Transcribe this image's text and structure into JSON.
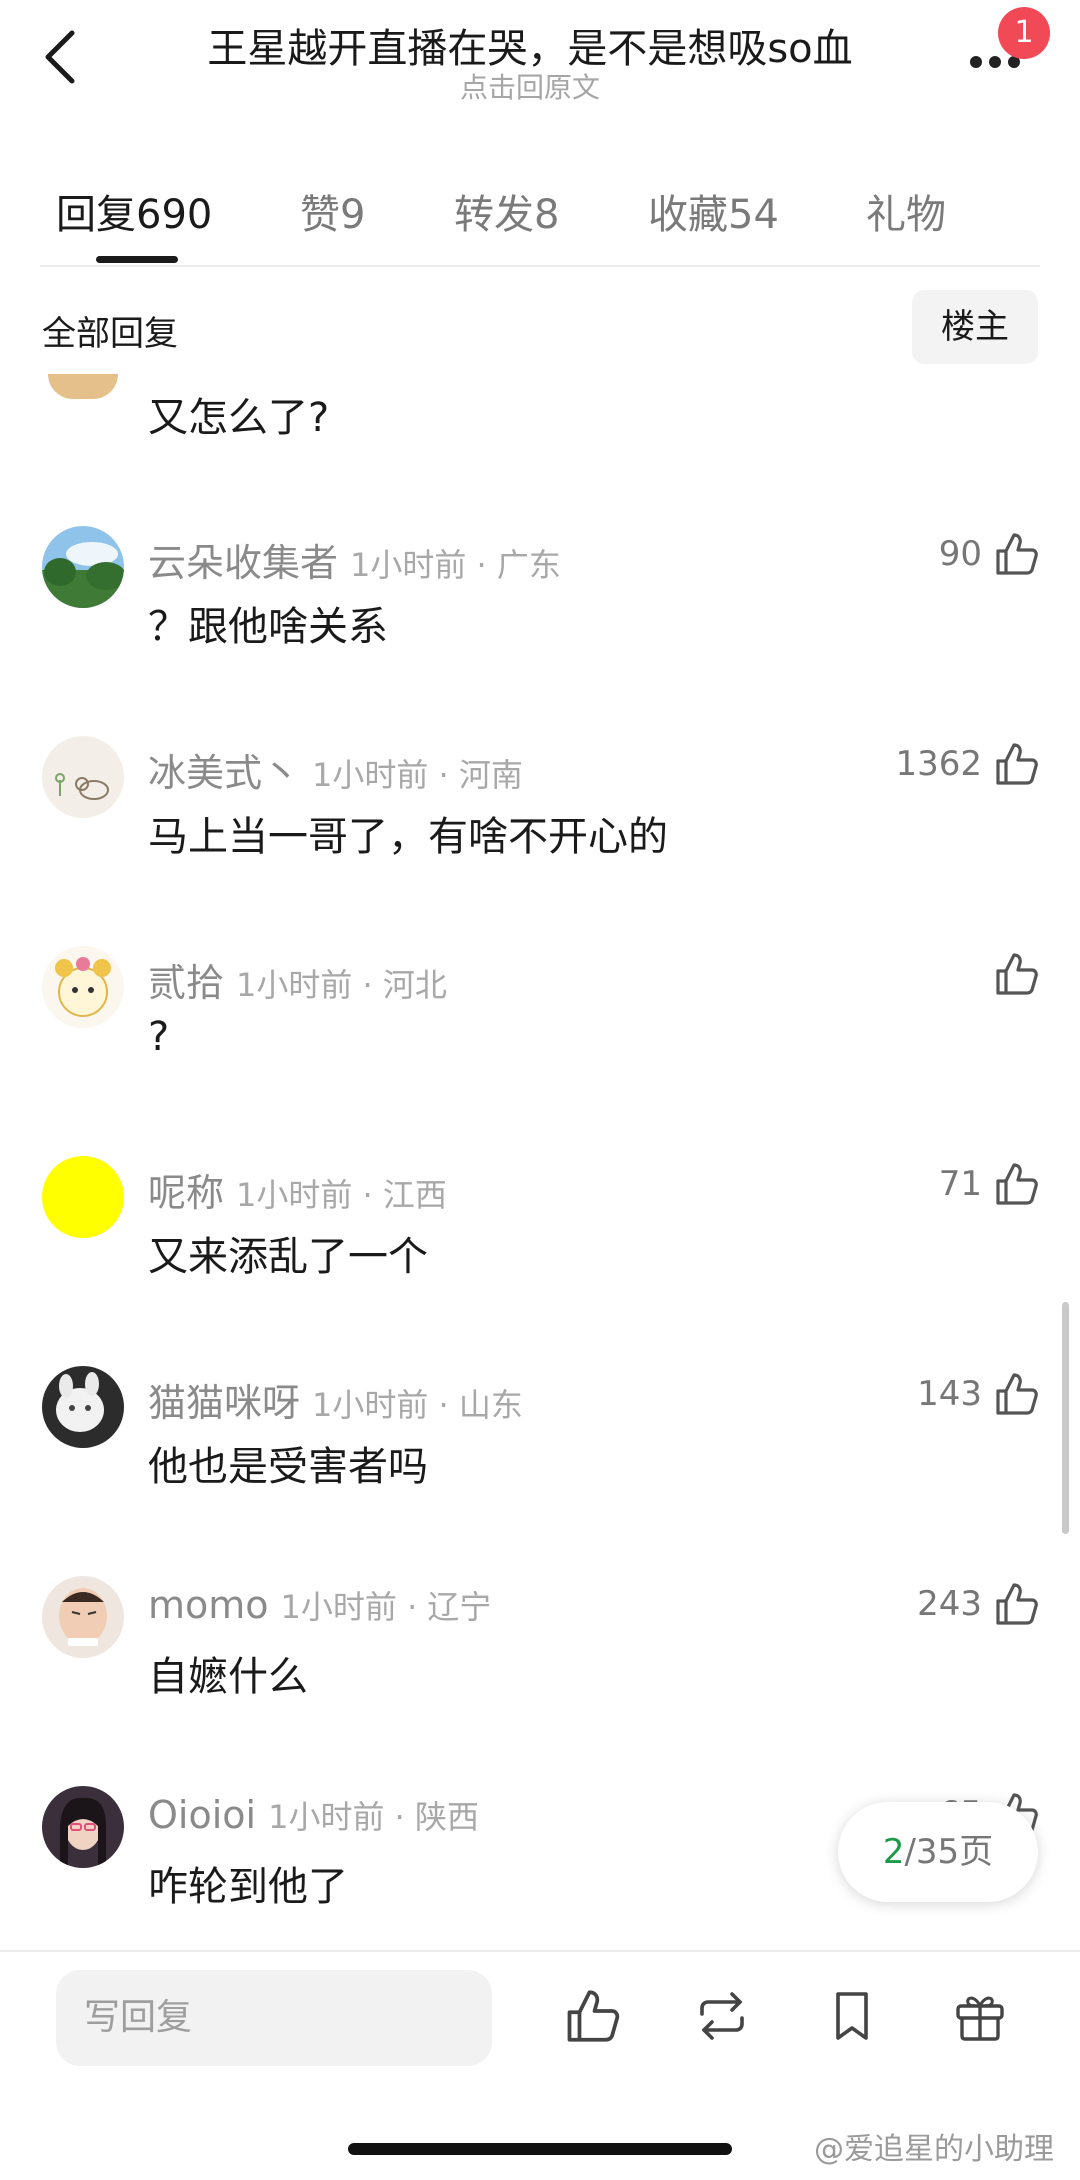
{
  "header": {
    "title": "王星越开直播在哭，是不是想吸so血",
    "subtitle": "点击回原文",
    "notification_badge": "1"
  },
  "tabs": [
    {
      "label": "回复690",
      "active": true
    },
    {
      "label": "赞9",
      "active": false
    },
    {
      "label": "转发8",
      "active": false
    },
    {
      "label": "收藏54",
      "active": false
    },
    {
      "label": "礼物",
      "active": false
    }
  ],
  "filter": {
    "label": "全部回复",
    "op_button": "楼主"
  },
  "partial_comment": {
    "text": "又怎么了?"
  },
  "comments": [
    {
      "username": "云朵收集者",
      "meta": "1小时前 · 广东",
      "text": "？跟他啥关系",
      "likes": "90",
      "avatar": "landscape-avatar"
    },
    {
      "username": "冰美式丶",
      "meta": "1小时前 · 河南",
      "text": "马上当一哥了，有啥不开心的",
      "likes": "1362",
      "avatar": "doodle-avatar"
    },
    {
      "username": "贰拾",
      "meta": "1小时前 · 河北",
      "text": "?",
      "likes": "",
      "avatar": "cartoon-avatar"
    },
    {
      "username": "呢称",
      "meta": "1小时前 · 江西",
      "text": "又来添乱了一个",
      "likes": "71",
      "avatar": "yellow-circle-avatar"
    },
    {
      "username": "猫猫咪呀",
      "meta": "1小时前 · 山东",
      "text": "他也是受害者吗",
      "likes": "143",
      "avatar": "cat-avatar"
    },
    {
      "username": "momo",
      "meta": "1小时前 · 辽宁",
      "text": "自嬷什么",
      "likes": "243",
      "avatar": "meme-avatar"
    },
    {
      "username": "Oioioi",
      "meta": "1小时前 · 陕西",
      "text": "咋轮到他了",
      "likes": "65",
      "avatar": "portrait-avatar"
    }
  ],
  "pagination": {
    "current": "2",
    "rest": "/35页"
  },
  "bottom_bar": {
    "reply_placeholder": "写回复"
  },
  "watermark": "@爱追星的小助理",
  "colors": {
    "accent_green": "#1f9a4a",
    "badge_red": "#f24957",
    "avatar_yellow": "#ffff00"
  }
}
